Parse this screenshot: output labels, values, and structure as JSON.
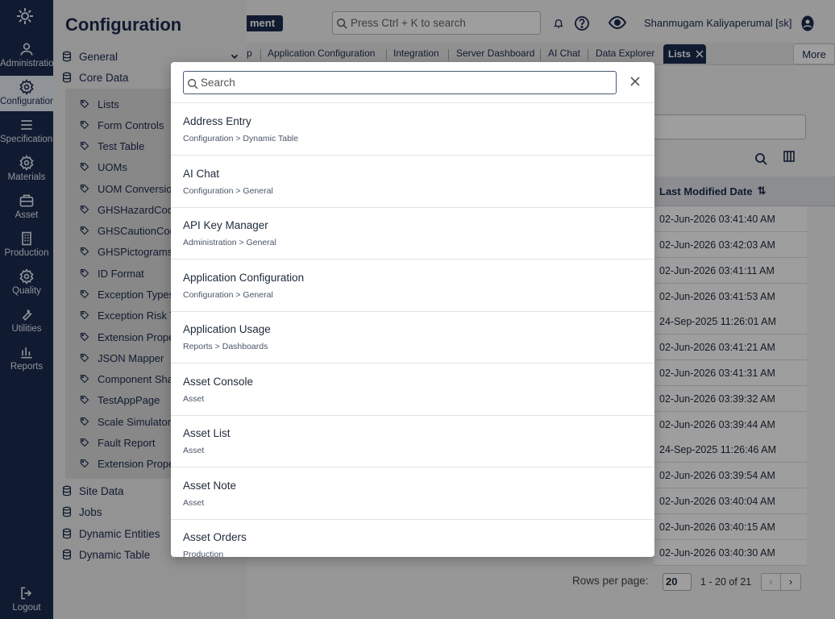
{
  "rail": {
    "items": [
      {
        "label": "Administration",
        "icon": "users-icon"
      },
      {
        "label": "Configuration",
        "icon": "gear-icon"
      },
      {
        "label": "Specifications",
        "icon": "list-icon"
      },
      {
        "label": "Materials",
        "icon": "gear-icon"
      },
      {
        "label": "Asset",
        "icon": "briefcase-icon"
      },
      {
        "label": "Production",
        "icon": "building-icon"
      },
      {
        "label": "Quality",
        "icon": "gear-icon"
      },
      {
        "label": "Utilities",
        "icon": "wrench-icon"
      },
      {
        "label": "Reports",
        "icon": "bar-chart-icon"
      }
    ],
    "logout_label": "Logout"
  },
  "config_panel": {
    "title": "Configuration",
    "groups": [
      "General",
      "Core Data",
      "Site Data",
      "Jobs",
      "Dynamic Entities",
      "Dynamic Table"
    ],
    "core_data_items": [
      "Lists",
      "Form Controls",
      "Test Table",
      "UOMs",
      "UOM Conversions",
      "GHSHazardCodes",
      "GHSCautionCodes",
      "GHSPictograms",
      "ID Format",
      "Exception Types",
      "Exception Risk Types",
      "Extension Properties",
      "JSON Mapper",
      "Component Shapes",
      "TestAppPage",
      "Scale Simulator",
      "Fault Report",
      "Extension Properties"
    ]
  },
  "header": {
    "badge_text": "ment",
    "search_placeholder": "Press Ctrl + K to search",
    "user_name": "Shanmugam Kaliyaperumal [sk]"
  },
  "tabs": {
    "items": [
      "p",
      "Application Configuration",
      "Integration",
      "Server Dashboard",
      "AI Chat",
      "Data Explorer"
    ],
    "active": "Lists",
    "more_label": "More"
  },
  "grid": {
    "column_header": "Last Modified Date",
    "rows": [
      "02-Jun-2026 03:41:40 AM",
      "02-Jun-2026 03:42:03 AM",
      "02-Jun-2026 03:41:11 AM",
      "02-Jun-2026 03:41:53 AM",
      "24-Sep-2025 11:26:01 AM",
      "02-Jun-2026 03:41:21 AM",
      "02-Jun-2026 03:41:31 AM",
      "02-Jun-2026 03:39:32 AM",
      "02-Jun-2026 03:39:44 AM",
      "24-Sep-2025 11:26:46 AM",
      "02-Jun-2026 03:39:54 AM",
      "02-Jun-2026 03:40:04 AM",
      "02-Jun-2026 03:40:15 AM",
      "02-Jun-2026 03:40:30 AM"
    ],
    "rows_per_page_label": "Rows per page:",
    "rows_per_page_value": "20",
    "page_range": "1 - 20 of 21"
  },
  "dialog": {
    "search_placeholder": "Search",
    "results": [
      {
        "title": "Address Entry",
        "path": "Configuration > Dynamic Table"
      },
      {
        "title": "AI Chat",
        "path": "Configuration > General"
      },
      {
        "title": "API Key Manager",
        "path": "Administration > General"
      },
      {
        "title": "Application Configuration",
        "path": "Configuration > General"
      },
      {
        "title": "Application Usage",
        "path": "Reports > Dashboards"
      },
      {
        "title": "Asset Console",
        "path": "Asset"
      },
      {
        "title": "Asset List",
        "path": "Asset"
      },
      {
        "title": "Asset Note",
        "path": "Asset"
      },
      {
        "title": "Asset Orders",
        "path": "Production"
      }
    ]
  },
  "colors": {
    "brand_navy": "#1b2a4e",
    "overlay": "#000000"
  }
}
